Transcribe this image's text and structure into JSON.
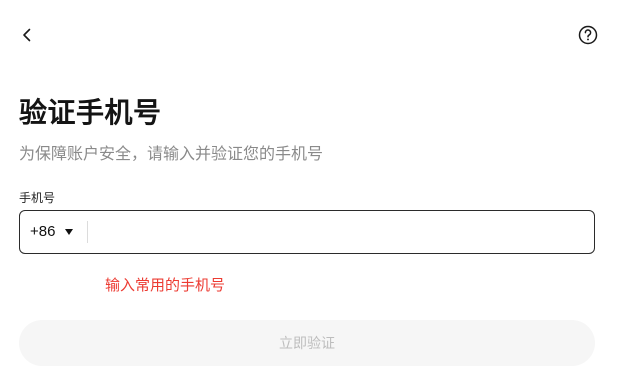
{
  "header": {
    "back_icon": "chevron-left-icon",
    "help_icon": "question-circle-icon"
  },
  "page": {
    "title": "验证手机号",
    "subtitle": "为保障账户安全，请输入并验证您的手机号"
  },
  "phone": {
    "label": "手机号",
    "country_code": "+86",
    "dropdown_icon": "caret-down-icon",
    "error": "输入常用的手机号"
  },
  "submit": {
    "label": "立即验证",
    "enabled": false
  },
  "colors": {
    "text_primary": "#141414",
    "text_secondary": "#8a8a8a",
    "error": "#ec3b32",
    "button_disabled_bg": "#f6f6f6",
    "button_disabled_text": "#bdbdbd"
  }
}
